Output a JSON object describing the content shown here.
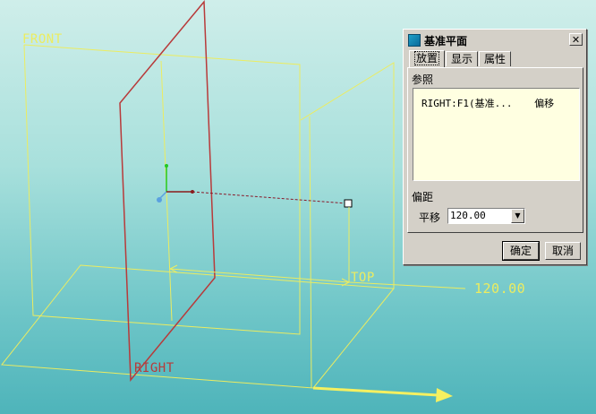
{
  "viewport": {
    "labels": {
      "front": "FRONT",
      "top": "TOP",
      "right": "RIGHT",
      "offset_readout": "120.00"
    },
    "colors": {
      "datum_plane": "#ecec60",
      "new_plane": "#b83a3a",
      "offset_arrow": "#f5f060"
    }
  },
  "dialog": {
    "title": "基准平面",
    "close_glyph": "✕",
    "tabs": [
      {
        "label": "放置",
        "active": true
      },
      {
        "label": "显示",
        "active": false
      },
      {
        "label": "属性",
        "active": false
      }
    ],
    "references_label": "参照",
    "reference": {
      "name": "RIGHT:F1(基准...",
      "constraint": "偏移"
    },
    "offset_label": "偏距",
    "translate_label": "平移",
    "offset_value": "120.00",
    "buttons": {
      "ok": "确定",
      "cancel": "取消"
    }
  }
}
